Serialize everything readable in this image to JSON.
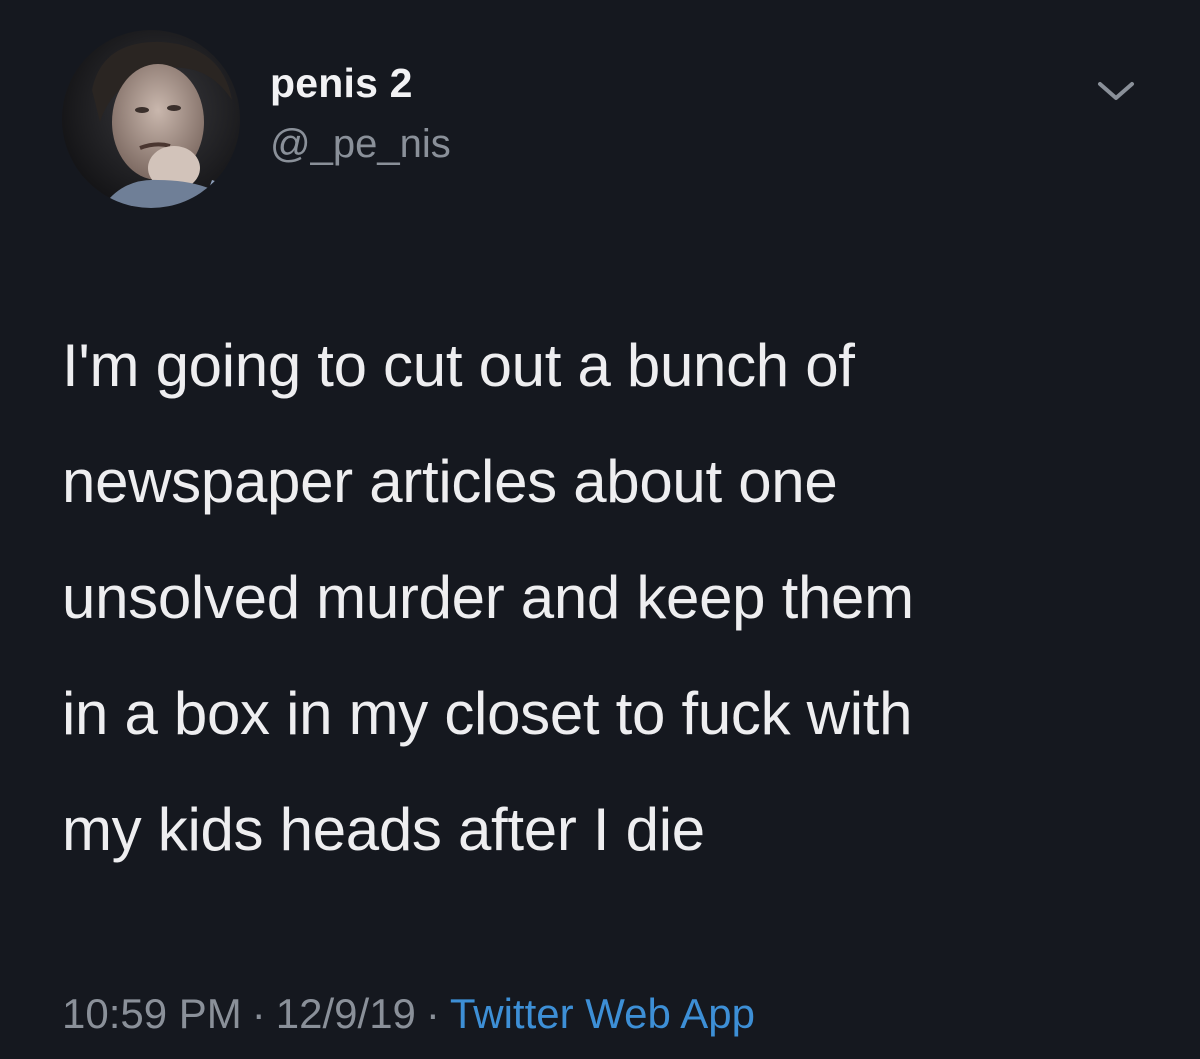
{
  "author": {
    "display_name": "penis 2",
    "handle": "@_pe_nis"
  },
  "tweet": {
    "lines": [
      "I'm going to cut out a bunch of",
      "newspaper articles about one",
      "unsolved murder and keep them",
      "in a box in my closet to fuck with",
      "my kids heads after I die"
    ]
  },
  "meta": {
    "time": "10:59 PM",
    "date": "12/9/19",
    "separator": "·",
    "source": "Twitter Web App"
  },
  "icons": {
    "menu": "chevron-down-icon",
    "avatar": "profile-photo"
  },
  "colors": {
    "background": "#15181f",
    "text": "#eeeef0",
    "muted": "#8a9099",
    "link": "#3d8fd6"
  }
}
